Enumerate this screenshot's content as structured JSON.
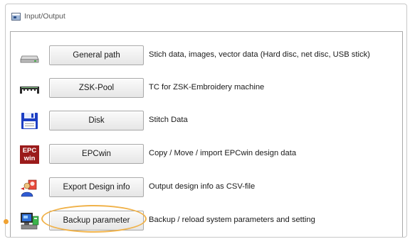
{
  "window": {
    "title": "Input/Output"
  },
  "rows": [
    {
      "button": "General path",
      "description": "Stich data, images, vector data (Hard disc, net disc, USB stick)",
      "icon": "hard-drive-icon"
    },
    {
      "button": "ZSK-Pool",
      "description": "TC for ZSK-Embroidery machine",
      "icon": "embroidery-machine-icon"
    },
    {
      "button": "Disk",
      "description": "Stitch Data",
      "icon": "floppy-disk-icon"
    },
    {
      "button": "EPCwin",
      "description": "Copy / Move / import EPCwin design data",
      "icon": "epcwin-logo-icon",
      "icon_text_top": "EPC",
      "icon_text_bottom": "win"
    },
    {
      "button": "Export Design info",
      "description": "Output design info as CSV-file",
      "icon": "export-user-icon"
    },
    {
      "button": "Backup parameter",
      "description": "Backup / reload system parameters and setting",
      "icon": "computer-backup-icon"
    }
  ],
  "colors": {
    "highlight": "#f0b24a",
    "epc_red": "#9b1b1b"
  }
}
